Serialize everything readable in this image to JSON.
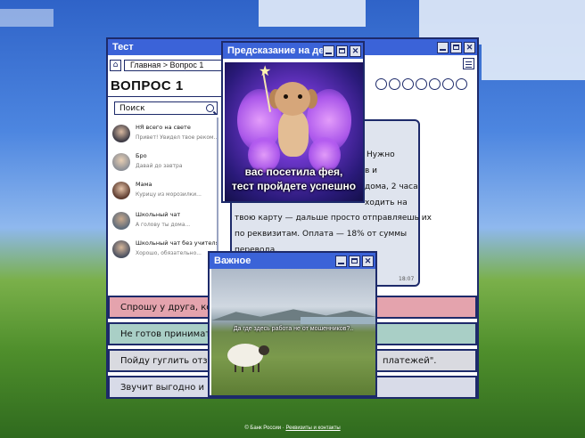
{
  "main_window": {
    "title": "Тест",
    "breadcrumb": "Главная > Вопрос 1",
    "question_title": "ВОПРОС 1",
    "search_placeholder": "Поиск",
    "chats": [
      {
        "name": "НЯ всего на свете",
        "preview": "Привет! Увидел твое реком..."
      },
      {
        "name": "Бро",
        "preview": "Давай до завтра"
      },
      {
        "name": "Мама",
        "preview": "Курицу из морозилки..."
      },
      {
        "name": "Школьный чат",
        "preview": "А голову ты дома..."
      },
      {
        "name": "Школьный чат без учителя",
        "preview": "Хорошо, обязательно..."
      }
    ],
    "message_lines": [
      "Нужно",
      "в и",
      "дома, 2 часа",
      "ходить на",
      "твою карту — дальше просто отправляешь их",
      "по реквизитам. Оплата — 18% от суммы",
      "перевода."
    ],
    "message_time": "18:07",
    "answers": [
      {
        "text": "Спрошу у друга, котор",
        "color": "#e4a3ad"
      },
      {
        "text": "Не готов принимать ч",
        "color": "#a9cfc6"
      },
      {
        "text": "Пойду гуглить отзывы",
        "suffix": "платежей\".",
        "color": "#d9dae0"
      },
      {
        "text": "Звучит выгодно и нес",
        "color": "#d8dbe8"
      }
    ]
  },
  "fairy_popup": {
    "title": "Предсказание на день",
    "caption_line1": "вас посетила фея,",
    "caption_line2": "тест пройдете успешно"
  },
  "important_popup": {
    "title": "Важное",
    "caption": "Да где здесь работа не от мошенников?.."
  },
  "footer": {
    "copyright": "© Банк России ·",
    "link": "Реквизиты и контакты"
  },
  "colors": {
    "titlebar": "#3b63d8",
    "border": "#1d2a6a"
  },
  "icons": [
    "home-icon",
    "search-icon",
    "menu-icon",
    "minimize-icon",
    "maximize-icon",
    "close-icon"
  ]
}
